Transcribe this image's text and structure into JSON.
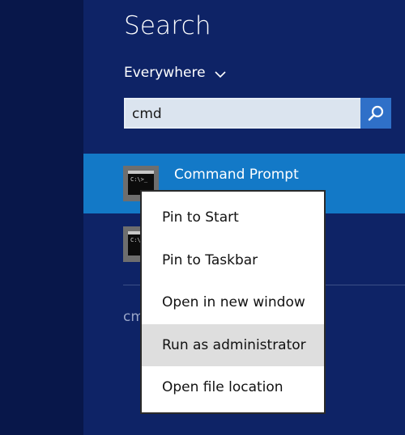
{
  "search": {
    "title": "Search",
    "scope_label": "Everywhere",
    "query": "cmd",
    "placeholder": ""
  },
  "results": [
    {
      "label": "Command Prompt",
      "icon": "command-prompt-icon",
      "selected": true
    },
    {
      "label": "",
      "icon": "command-prompt-icon",
      "selected": false
    }
  ],
  "web_suggestion": "cm",
  "context_menu": {
    "items": [
      {
        "label": "Pin to Start"
      },
      {
        "label": "Pin to Taskbar"
      },
      {
        "label": "Open in new window"
      },
      {
        "label": "Run as administrator",
        "highlighted": true
      },
      {
        "label": "Open file location"
      }
    ]
  },
  "colors": {
    "panel_bg": "#0e2366",
    "left_strip_bg": "#08174a",
    "selected_result_bg": "#1379c7",
    "search_button_bg": "#2f70c8",
    "menu_highlight_bg": "#dedede"
  },
  "icons": {
    "prompt_glyph": "C:\\>_"
  }
}
